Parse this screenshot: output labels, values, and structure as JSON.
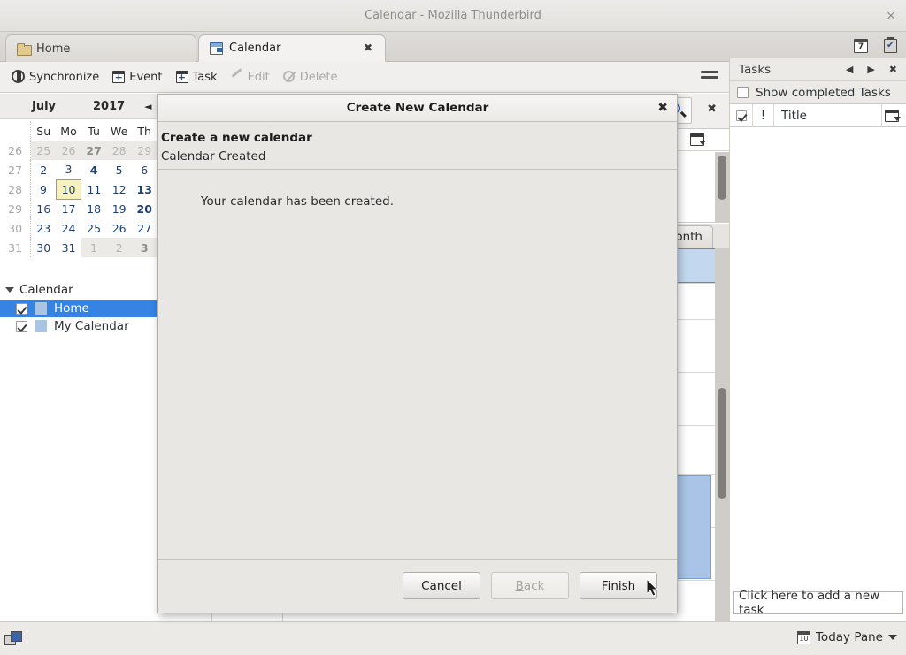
{
  "window": {
    "title": "Calendar - Mozilla Thunderbird",
    "close_label": "×"
  },
  "tabs": [
    {
      "label": "Home",
      "icon": "folder-icon",
      "active": false
    },
    {
      "label": "Calendar",
      "icon": "calendar-icon",
      "active": true,
      "close_label": "✖"
    }
  ],
  "tabstrip_icons": [
    {
      "name": "calendar-tab-icon",
      "glyph": "7"
    },
    {
      "name": "tasks-tab-icon",
      "glyph": "✔"
    }
  ],
  "toolbar": {
    "buttons": [
      {
        "label": "Synchronize",
        "icon": "synchronize-icon",
        "disabled": false
      },
      {
        "label": "Event",
        "icon": "new-event-icon",
        "disabled": false
      },
      {
        "label": "Task",
        "icon": "new-task-icon",
        "disabled": false
      },
      {
        "label": "Edit",
        "icon": "edit-icon",
        "disabled": true
      },
      {
        "label": "Delete",
        "icon": "delete-icon",
        "disabled": true
      }
    ],
    "menu_label": "app-menu"
  },
  "minicalendar": {
    "month": "July",
    "year": "2017",
    "prev_label": "◄",
    "weekday_headers": [
      "Su",
      "Mo",
      "Tu",
      "We",
      "Th"
    ],
    "week_numbers": [
      "26",
      "27",
      "28",
      "29",
      "30",
      "31"
    ],
    "weeks": [
      [
        {
          "d": "25",
          "state": "other"
        },
        {
          "d": "26",
          "state": "other"
        },
        {
          "d": "27",
          "state": "other-bold"
        },
        {
          "d": "28",
          "state": "other"
        },
        {
          "d": "29",
          "state": "other"
        }
      ],
      [
        {
          "d": "2",
          "state": "current"
        },
        {
          "d": "3",
          "state": "current"
        },
        {
          "d": "4",
          "state": "current-bold"
        },
        {
          "d": "5",
          "state": "current"
        },
        {
          "d": "6",
          "state": "current"
        }
      ],
      [
        {
          "d": "9",
          "state": "current"
        },
        {
          "d": "10",
          "state": "today"
        },
        {
          "d": "11",
          "state": "current"
        },
        {
          "d": "12",
          "state": "current"
        },
        {
          "d": "13",
          "state": "current-bold"
        }
      ],
      [
        {
          "d": "16",
          "state": "current"
        },
        {
          "d": "17",
          "state": "current"
        },
        {
          "d": "18",
          "state": "current"
        },
        {
          "d": "19",
          "state": "current"
        },
        {
          "d": "20",
          "state": "current-bold"
        }
      ],
      [
        {
          "d": "23",
          "state": "current"
        },
        {
          "d": "24",
          "state": "current"
        },
        {
          "d": "25",
          "state": "current"
        },
        {
          "d": "26",
          "state": "current"
        },
        {
          "d": "27",
          "state": "current"
        }
      ],
      [
        {
          "d": "30",
          "state": "current"
        },
        {
          "d": "31",
          "state": "current"
        },
        {
          "d": "1",
          "state": "other"
        },
        {
          "d": "2",
          "state": "other"
        },
        {
          "d": "3",
          "state": "other-bold"
        }
      ]
    ]
  },
  "calendar_list": {
    "header": "Calendar",
    "items": [
      {
        "label": "Home",
        "checked": true,
        "selected": true,
        "color": "#aac4e4"
      },
      {
        "label": "My Calendar",
        "checked": true,
        "selected": false,
        "color": "#aac4e4"
      }
    ]
  },
  "mainview": {
    "search_icon": "search-icon",
    "search_close": "✖",
    "column_menu": "column-options-icon",
    "view_tab": "Month"
  },
  "tasks": {
    "title": "Tasks",
    "prev_label": "◀",
    "next_label": "▶",
    "close_label": "✖",
    "show_completed_label": "Show completed Tasks",
    "show_completed_checked": false,
    "columns": [
      "✔",
      "!",
      "Title"
    ],
    "column_menu": "column-options-icon",
    "new_task_placeholder": "Click here to add a new task"
  },
  "statusbar": {
    "offline_icon": "offline-status-icon",
    "today_pane_label": "Today Pane",
    "today_pane_glyph": "10"
  },
  "dialog": {
    "title": "Create New Calendar",
    "close_label": "✖",
    "heading": "Create a new calendar",
    "subheading": "Calendar Created",
    "message": "Your calendar has been created.",
    "buttons": {
      "cancel": "Cancel",
      "back_accel": "B",
      "back_rest": "ack",
      "finish": "Finish"
    }
  },
  "colors": {
    "accent": "#3584e4",
    "selection": "#c3d8ef",
    "event": "#a9c4e6",
    "today": "#f7f0bf"
  }
}
